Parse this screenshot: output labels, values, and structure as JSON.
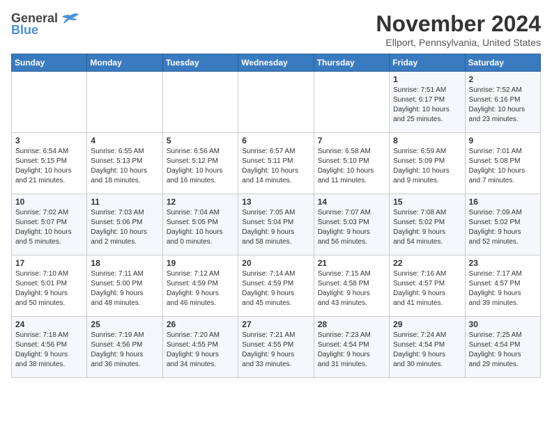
{
  "header": {
    "logo_general": "General",
    "logo_blue": "Blue",
    "month_title": "November 2024",
    "location": "Ellport, Pennsylvania, United States"
  },
  "weekdays": [
    "Sunday",
    "Monday",
    "Tuesday",
    "Wednesday",
    "Thursday",
    "Friday",
    "Saturday"
  ],
  "weeks": [
    [
      {
        "day": "",
        "info": ""
      },
      {
        "day": "",
        "info": ""
      },
      {
        "day": "",
        "info": ""
      },
      {
        "day": "",
        "info": ""
      },
      {
        "day": "",
        "info": ""
      },
      {
        "day": "1",
        "info": "Sunrise: 7:51 AM\nSunset: 6:17 PM\nDaylight: 10 hours\nand 25 minutes."
      },
      {
        "day": "2",
        "info": "Sunrise: 7:52 AM\nSunset: 6:16 PM\nDaylight: 10 hours\nand 23 minutes."
      }
    ],
    [
      {
        "day": "3",
        "info": "Sunrise: 6:54 AM\nSunset: 5:15 PM\nDaylight: 10 hours\nand 21 minutes."
      },
      {
        "day": "4",
        "info": "Sunrise: 6:55 AM\nSunset: 5:13 PM\nDaylight: 10 hours\nand 18 minutes."
      },
      {
        "day": "5",
        "info": "Sunrise: 6:56 AM\nSunset: 5:12 PM\nDaylight: 10 hours\nand 16 minutes."
      },
      {
        "day": "6",
        "info": "Sunrise: 6:57 AM\nSunset: 5:11 PM\nDaylight: 10 hours\nand 14 minutes."
      },
      {
        "day": "7",
        "info": "Sunrise: 6:58 AM\nSunset: 5:10 PM\nDaylight: 10 hours\nand 11 minutes."
      },
      {
        "day": "8",
        "info": "Sunrise: 6:59 AM\nSunset: 5:09 PM\nDaylight: 10 hours\nand 9 minutes."
      },
      {
        "day": "9",
        "info": "Sunrise: 7:01 AM\nSunset: 5:08 PM\nDaylight: 10 hours\nand 7 minutes."
      }
    ],
    [
      {
        "day": "10",
        "info": "Sunrise: 7:02 AM\nSunset: 5:07 PM\nDaylight: 10 hours\nand 5 minutes."
      },
      {
        "day": "11",
        "info": "Sunrise: 7:03 AM\nSunset: 5:06 PM\nDaylight: 10 hours\nand 2 minutes."
      },
      {
        "day": "12",
        "info": "Sunrise: 7:04 AM\nSunset: 5:05 PM\nDaylight: 10 hours\nand 0 minutes."
      },
      {
        "day": "13",
        "info": "Sunrise: 7:05 AM\nSunset: 5:04 PM\nDaylight: 9 hours\nand 58 minutes."
      },
      {
        "day": "14",
        "info": "Sunrise: 7:07 AM\nSunset: 5:03 PM\nDaylight: 9 hours\nand 56 minutes."
      },
      {
        "day": "15",
        "info": "Sunrise: 7:08 AM\nSunset: 5:02 PM\nDaylight: 9 hours\nand 54 minutes."
      },
      {
        "day": "16",
        "info": "Sunrise: 7:09 AM\nSunset: 5:02 PM\nDaylight: 9 hours\nand 52 minutes."
      }
    ],
    [
      {
        "day": "17",
        "info": "Sunrise: 7:10 AM\nSunset: 5:01 PM\nDaylight: 9 hours\nand 50 minutes."
      },
      {
        "day": "18",
        "info": "Sunrise: 7:11 AM\nSunset: 5:00 PM\nDaylight: 9 hours\nand 48 minutes."
      },
      {
        "day": "19",
        "info": "Sunrise: 7:12 AM\nSunset: 4:59 PM\nDaylight: 9 hours\nand 46 minutes."
      },
      {
        "day": "20",
        "info": "Sunrise: 7:14 AM\nSunset: 4:59 PM\nDaylight: 9 hours\nand 45 minutes."
      },
      {
        "day": "21",
        "info": "Sunrise: 7:15 AM\nSunset: 4:58 PM\nDaylight: 9 hours\nand 43 minutes."
      },
      {
        "day": "22",
        "info": "Sunrise: 7:16 AM\nSunset: 4:57 PM\nDaylight: 9 hours\nand 41 minutes."
      },
      {
        "day": "23",
        "info": "Sunrise: 7:17 AM\nSunset: 4:57 PM\nDaylight: 9 hours\nand 39 minutes."
      }
    ],
    [
      {
        "day": "24",
        "info": "Sunrise: 7:18 AM\nSunset: 4:56 PM\nDaylight: 9 hours\nand 38 minutes."
      },
      {
        "day": "25",
        "info": "Sunrise: 7:19 AM\nSunset: 4:56 PM\nDaylight: 9 hours\nand 36 minutes."
      },
      {
        "day": "26",
        "info": "Sunrise: 7:20 AM\nSunset: 4:55 PM\nDaylight: 9 hours\nand 34 minutes."
      },
      {
        "day": "27",
        "info": "Sunrise: 7:21 AM\nSunset: 4:55 PM\nDaylight: 9 hours\nand 33 minutes."
      },
      {
        "day": "28",
        "info": "Sunrise: 7:23 AM\nSunset: 4:54 PM\nDaylight: 9 hours\nand 31 minutes."
      },
      {
        "day": "29",
        "info": "Sunrise: 7:24 AM\nSunset: 4:54 PM\nDaylight: 9 hours\nand 30 minutes."
      },
      {
        "day": "30",
        "info": "Sunrise: 7:25 AM\nSunset: 4:54 PM\nDaylight: 9 hours\nand 29 minutes."
      }
    ]
  ]
}
